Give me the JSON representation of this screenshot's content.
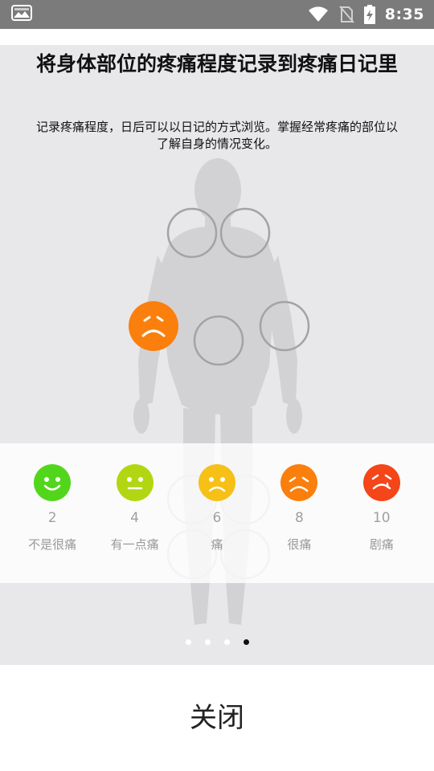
{
  "status_bar": {
    "time": "8:35",
    "icons": [
      "gallery-icon",
      "wifi-icon",
      "no-sim-icon",
      "battery-charging-icon"
    ]
  },
  "onboarding": {
    "title": "将身体部位的疼痛程度记录到疼痛日记里",
    "subtitle": "记录疼痛程度，日后可以以日记的方式浏览。掌握经常疼痛的部位以了解自身的情况变化。",
    "pain_scale": [
      {
        "value": "2",
        "label": "不是很痛",
        "color": "#52d61c",
        "face": "happy-face-icon"
      },
      {
        "value": "4",
        "label": "有一点痛",
        "color": "#b3d612",
        "face": "neutral-face-icon"
      },
      {
        "value": "6",
        "label": "痛",
        "color": "#f6c016",
        "face": "sad-face-icon"
      },
      {
        "value": "8",
        "label": "很痛",
        "color": "#fb7f0d",
        "face": "worried-face-icon"
      },
      {
        "value": "10",
        "label": "剧痛",
        "color": "#f44619",
        "face": "crying-face-icon"
      }
    ],
    "selected_marker_color": "#fb7f0d",
    "page_indicator": {
      "total": 4,
      "current": 4
    }
  },
  "footer": {
    "close_label": "关闭"
  }
}
